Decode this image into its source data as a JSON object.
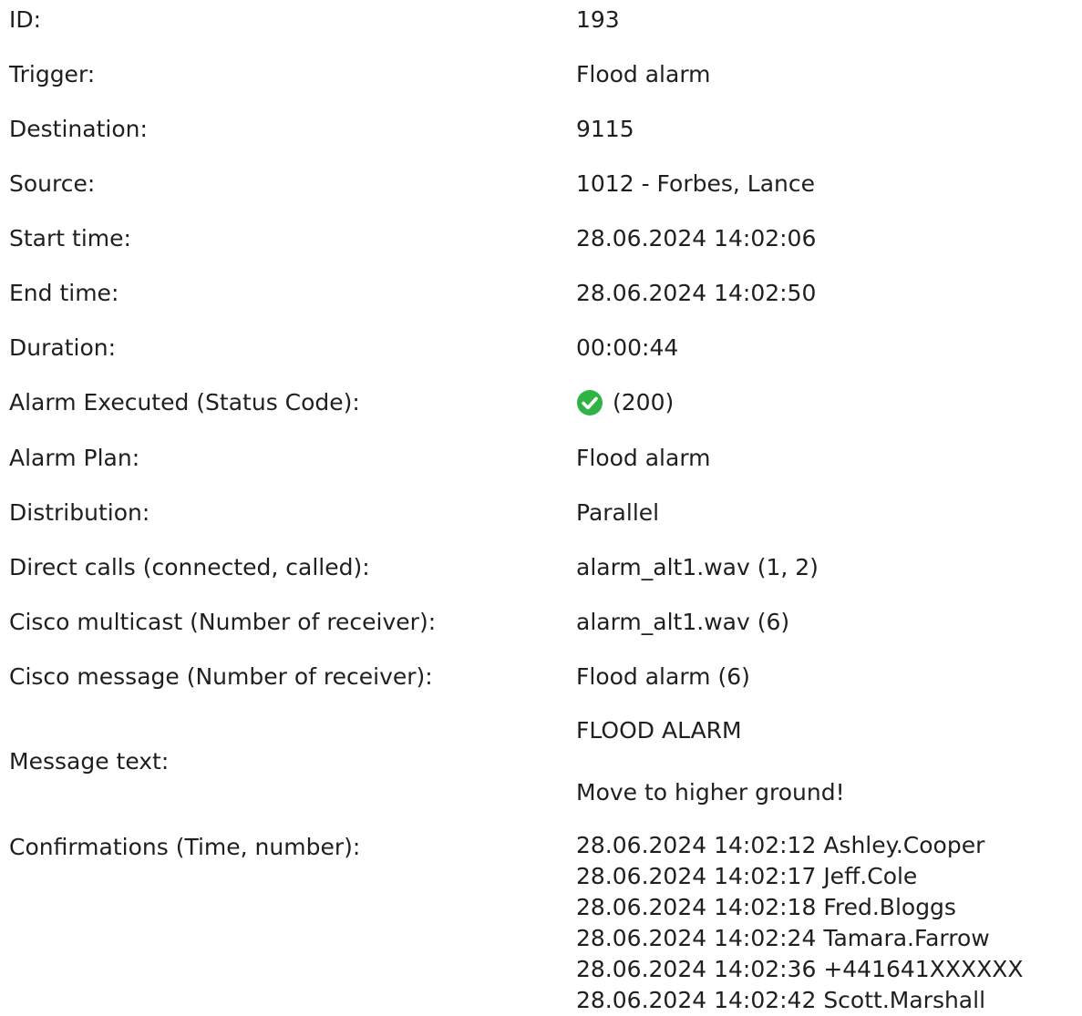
{
  "fields": {
    "id": {
      "label": "ID:",
      "value": "193"
    },
    "trigger": {
      "label": "Trigger:",
      "value": "Flood alarm"
    },
    "destination": {
      "label": "Destination:",
      "value": "9115"
    },
    "source": {
      "label": "Source:",
      "value": "1012 - Forbes, Lance"
    },
    "start_time": {
      "label": "Start time:",
      "value": "28.06.2024 14:02:06"
    },
    "end_time": {
      "label": "End time:",
      "value": "28.06.2024 14:02:50"
    },
    "duration": {
      "label": "Duration:",
      "value": "00:00:44"
    },
    "alarm_executed": {
      "label": "Alarm Executed (Status Code):",
      "value": "(200)",
      "icon": "check-circle-icon",
      "icon_color": "#2fb344"
    },
    "alarm_plan": {
      "label": "Alarm Plan:",
      "value": "Flood alarm"
    },
    "distribution": {
      "label": "Distribution:",
      "value": "Parallel"
    },
    "direct_calls": {
      "label": "Direct calls (connected, called):",
      "value": "alarm_alt1.wav (1, 2)"
    },
    "cisco_multicast": {
      "label": "Cisco multicast (Number of receiver):",
      "value": "alarm_alt1.wav (6)"
    },
    "cisco_message": {
      "label": "Cisco message (Number of receiver):",
      "value": "Flood alarm (6)"
    },
    "message_text": {
      "label": "Message text:",
      "lines": [
        "FLOOD ALARM",
        "Move to higher ground!"
      ]
    },
    "confirmations": {
      "label": "Confirmations (Time, number):",
      "items": [
        "28.06.2024 14:02:12 Ashley.Cooper",
        "28.06.2024 14:02:17 Jeff.Cole",
        "28.06.2024 14:02:18 Fred.Bloggs",
        "28.06.2024 14:02:24 Tamara.Farrow",
        "28.06.2024 14:02:36 +441641XXXXXX",
        "28.06.2024 14:02:42 Scott.Marshall"
      ]
    }
  }
}
